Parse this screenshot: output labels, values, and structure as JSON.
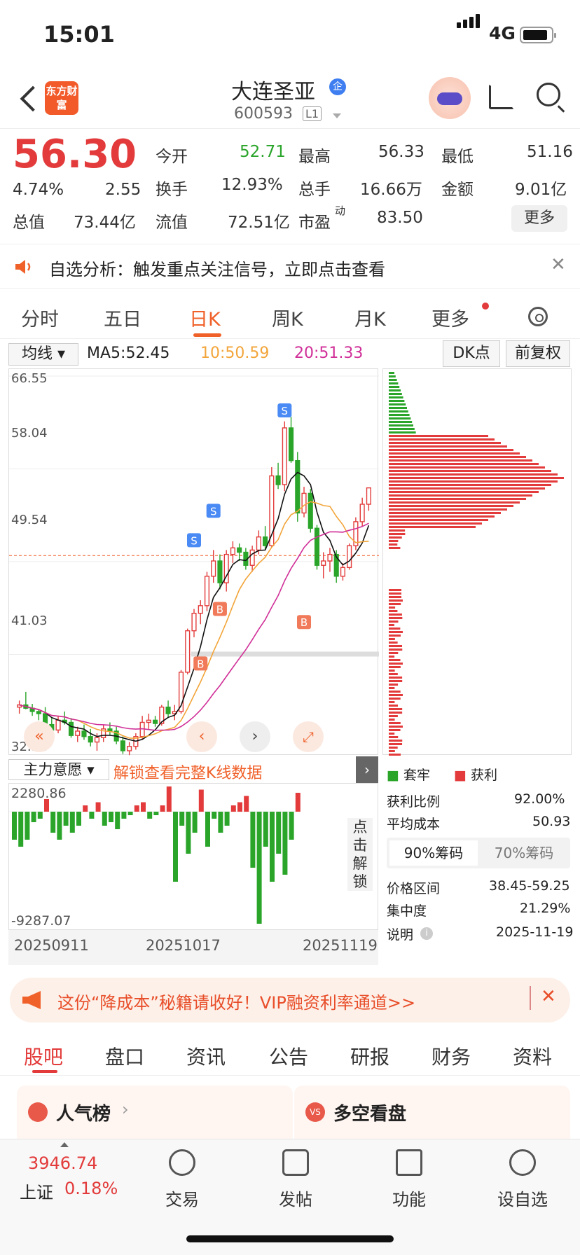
{
  "status": {
    "time": "15:01",
    "network": "4G"
  },
  "header": {
    "stock_name": "大连圣亚",
    "badge": "企",
    "code": "600593",
    "level": "L1",
    "logo_text": "东方财富"
  },
  "quote": {
    "price": "56.30",
    "pct": "4.74%",
    "change": "2.55",
    "open_label": "今开",
    "open": "52.71",
    "high_label": "最高",
    "high": "56.33",
    "low_label": "最低",
    "low": "51.16",
    "turnover_label": "换手",
    "turnover": "12.93%",
    "volume_label": "总手",
    "volume": "16.66万",
    "amount_label": "金额",
    "amount": "9.01亿",
    "mktcap_label": "总值",
    "mktcap": "73.44亿",
    "float_label": "流值",
    "float": "72.51亿",
    "pe_label": "市盈",
    "pe_sup": "动",
    "pe": "83.50",
    "more": "更多"
  },
  "notice": {
    "text": "自选分析：触发重点关注信号，立即点击查看"
  },
  "tabs": [
    "分时",
    "五日",
    "日K",
    "周K",
    "月K",
    "更多"
  ],
  "active_tab": "日K",
  "indicators": {
    "ma_select": "均线",
    "ma5": "MA5:52.45",
    "ma10": "10:50.59",
    "ma20": "20:51.33",
    "dk": "DK点",
    "adjust": "前复权"
  },
  "chart_data": {
    "type": "candlestick",
    "y_ticks": [
      "66.55",
      "58.04",
      "49.54",
      "41.03",
      "32.52"
    ],
    "ylim": [
      32.52,
      66.55
    ],
    "current_line": 50.1,
    "dates": [
      "20250911",
      "20251017",
      "20251119"
    ],
    "candles": [
      [
        36.2,
        36.8,
        35.6,
        36.4
      ],
      [
        36.4,
        37.6,
        36.0,
        36.1
      ],
      [
        36.1,
        36.5,
        35.4,
        35.8
      ],
      [
        35.8,
        36.0,
        35.0,
        35.6
      ],
      [
        35.6,
        36.2,
        34.2,
        34.6
      ],
      [
        34.6,
        35.2,
        33.6,
        34.1
      ],
      [
        34.1,
        35.4,
        33.8,
        35.0
      ],
      [
        35.0,
        35.8,
        34.6,
        34.8
      ],
      [
        34.8,
        35.2,
        33.4,
        33.6
      ],
      [
        33.6,
        34.4,
        33.0,
        34.0
      ],
      [
        34.0,
        34.6,
        33.2,
        33.5
      ],
      [
        33.5,
        34.2,
        32.6,
        33.0
      ],
      [
        33.0,
        33.8,
        32.2,
        33.4
      ],
      [
        33.4,
        34.6,
        33.0,
        34.2
      ],
      [
        34.2,
        34.8,
        33.6,
        34.0
      ],
      [
        34.0,
        34.4,
        32.8,
        33.1
      ],
      [
        33.1,
        33.5,
        31.9,
        32.2
      ],
      [
        32.2,
        33.0,
        31.8,
        32.6
      ],
      [
        32.6,
        33.8,
        32.3,
        33.5
      ],
      [
        33.5,
        35.4,
        33.2,
        34.8
      ],
      [
        34.8,
        35.6,
        34.2,
        35.0
      ],
      [
        35.0,
        35.4,
        34.4,
        34.7
      ],
      [
        34.7,
        36.4,
        34.5,
        36.2
      ],
      [
        36.2,
        36.8,
        35.2,
        35.6
      ],
      [
        35.6,
        36.4,
        35.0,
        35.8
      ],
      [
        35.8,
        39.6,
        35.6,
        39.4
      ],
      [
        39.4,
        43.4,
        39.2,
        43.2
      ],
      [
        43.2,
        45.2,
        42.6,
        44.8
      ],
      [
        44.8,
        46.0,
        43.8,
        45.5
      ],
      [
        45.5,
        48.6,
        45.0,
        48.2
      ],
      [
        48.2,
        50.6,
        47.6,
        49.6
      ],
      [
        49.6,
        50.2,
        47.0,
        47.6
      ],
      [
        47.6,
        50.6,
        46.8,
        50.2
      ],
      [
        50.2,
        51.4,
        49.4,
        50.8
      ],
      [
        50.8,
        51.2,
        49.6,
        50.4
      ],
      [
        50.4,
        50.8,
        48.8,
        49.2
      ],
      [
        49.2,
        51.0,
        48.6,
        50.6
      ],
      [
        50.6,
        52.4,
        50.2,
        51.8
      ],
      [
        51.8,
        52.8,
        50.6,
        51.0
      ],
      [
        51.0,
        58.2,
        50.8,
        57.4
      ],
      [
        57.4,
        58.6,
        56.2,
        56.6
      ],
      [
        56.6,
        62.4,
        56.0,
        61.8
      ],
      [
        61.8,
        62.8,
        58.6,
        58.8
      ],
      [
        58.8,
        59.6,
        53.2,
        54.0
      ],
      [
        54.0,
        56.4,
        53.6,
        55.8
      ],
      [
        55.8,
        56.2,
        52.2,
        52.6
      ],
      [
        52.6,
        52.9,
        48.8,
        49.2
      ],
      [
        49.2,
        50.4,
        48.0,
        49.6
      ],
      [
        49.6,
        50.8,
        48.6,
        50.2
      ],
      [
        50.2,
        50.6,
        47.6,
        48.2
      ],
      [
        48.2,
        49.4,
        47.8,
        49.0
      ],
      [
        49.0,
        51.2,
        48.8,
        51.0
      ],
      [
        51.0,
        53.6,
        50.6,
        53.2
      ],
      [
        53.2,
        55.4,
        52.8,
        54.8
      ],
      [
        54.8,
        56.33,
        54.2,
        56.3
      ]
    ],
    "buy_sell_marks": [
      "S",
      "S",
      "S",
      "B",
      "B",
      "B",
      "B"
    ],
    "distribution": {
      "profit_label": "获利比例",
      "profit": "92.00%",
      "avg_cost_label": "平均成本",
      "avg_cost": "50.93",
      "tab_90": "90%筹码",
      "tab_70": "70%筹码",
      "range_label": "价格区间",
      "range": "38.45-59.25",
      "concentration_label": "集中度",
      "concentration": "21.29%",
      "date_label": "说明",
      "date": "2025-11-19",
      "legend_trapped": "套牢",
      "legend_profit": "获利"
    },
    "flow": {
      "label": "主力意愿",
      "max": "2280.86",
      "min": "-9287.07",
      "unlock": "解锁查看完整K线数据",
      "side_unlock": "点击解锁"
    }
  },
  "banner": {
    "text": "这份“降成本”秘籍请收好！VIP融资利率通道>>"
  },
  "bottom_tabs": [
    "股吧",
    "盘口",
    "资讯",
    "公告",
    "研报",
    "财务",
    "资料"
  ],
  "cards": [
    {
      "title": "人气榜"
    },
    {
      "title": "多空看盘"
    }
  ],
  "footer": {
    "index_value": "3946.74",
    "index_name": "上证",
    "index_pct": "0.18%",
    "items": [
      "交易",
      "发帖",
      "功能",
      "设自选"
    ]
  },
  "colors": {
    "red": "#e33b3b",
    "green": "#2aa52a",
    "accent": "#f0612a"
  }
}
